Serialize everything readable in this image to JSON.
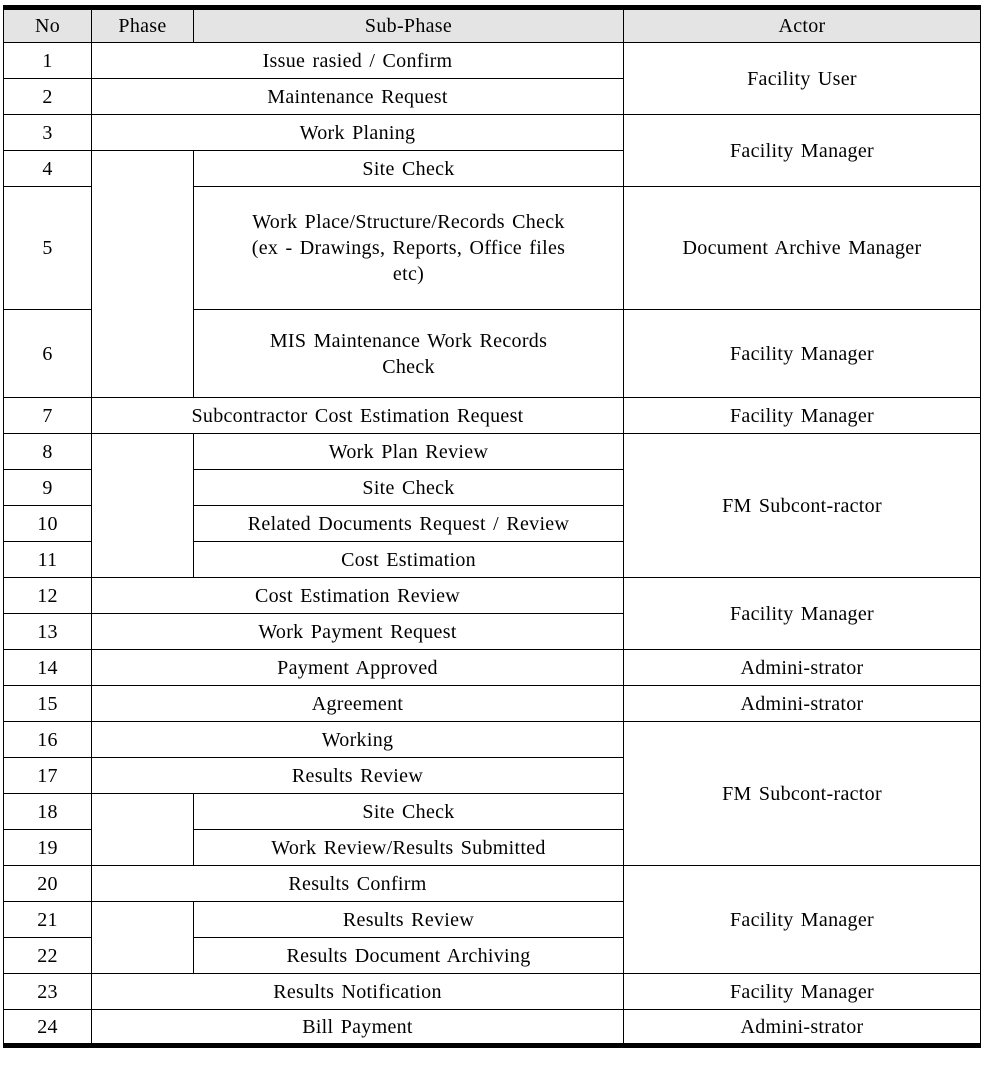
{
  "table": {
    "headers": {
      "no": "No",
      "phase": "Phase",
      "sub_phase": "Sub-Phase",
      "actor": "Actor"
    },
    "header_bg": "#e4e4e4",
    "border_color": "#000000",
    "rows": [
      {
        "no": "1",
        "sub_phase": "Issue rasied / Confirm",
        "indent": false,
        "actor": "Facility User",
        "actor_rowspan": 2
      },
      {
        "no": "2",
        "sub_phase": "Maintenance Request",
        "indent": false,
        "actor": null,
        "actor_rowspan": 0
      },
      {
        "no": "3",
        "sub_phase": "Work Planing",
        "indent": false,
        "actor": "Facility Manager",
        "actor_rowspan": 2
      },
      {
        "no": "4",
        "sub_phase": "Site Check",
        "indent": true,
        "actor": null,
        "actor_rowspan": 0
      },
      {
        "no": "5",
        "sub_phase": "Work Place/Structure/Records Check (ex - Drawings, Reports, Office files etc)",
        "sub_phase_lines": [
          "Work Place/Structure/Records Check",
          "(ex - Drawings, Reports, Office files",
          "etc)"
        ],
        "indent": true,
        "actor": "Document Archive Manager",
        "actor_rowspan": 1
      },
      {
        "no": "6",
        "sub_phase": "MIS Maintenance Work Records Check",
        "sub_phase_lines": [
          "MIS Maintenance Work Records",
          "Check"
        ],
        "indent": true,
        "actor": "Facility Manager",
        "actor_rowspan": 1
      },
      {
        "no": "7",
        "sub_phase": "Subcontractor Cost Estimation Request",
        "indent": false,
        "actor": "Facility Manager",
        "actor_rowspan": 1
      },
      {
        "no": "8",
        "sub_phase": "Work Plan Review",
        "indent": true,
        "actor": "FM Subcont-ractor",
        "actor_rowspan": 4
      },
      {
        "no": "9",
        "sub_phase": "Site Check",
        "indent": true,
        "actor": null,
        "actor_rowspan": 0
      },
      {
        "no": "10",
        "sub_phase": "Related Documents Request / Review",
        "indent": true,
        "actor": null,
        "actor_rowspan": 0
      },
      {
        "no": "11",
        "sub_phase": "Cost Estimation",
        "indent": true,
        "actor": null,
        "actor_rowspan": 0
      },
      {
        "no": "12",
        "sub_phase": "Cost Estimation Review",
        "indent": false,
        "actor": "Facility Manager",
        "actor_rowspan": 2
      },
      {
        "no": "13",
        "sub_phase": "Work Payment Request",
        "indent": false,
        "actor": null,
        "actor_rowspan": 0
      },
      {
        "no": "14",
        "sub_phase": "Payment Approved",
        "indent": false,
        "actor": "Admini-strator",
        "actor_rowspan": 1
      },
      {
        "no": "15",
        "sub_phase": "Agreement",
        "indent": false,
        "actor": "Admini-strator",
        "actor_rowspan": 1
      },
      {
        "no": "16",
        "sub_phase": "Working",
        "indent": false,
        "actor": "FM Subcont-ractor",
        "actor_rowspan": 4
      },
      {
        "no": "17",
        "sub_phase": "Results Review",
        "indent": false,
        "actor": null,
        "actor_rowspan": 0
      },
      {
        "no": "18",
        "sub_phase": "Site Check",
        "indent": true,
        "actor": null,
        "actor_rowspan": 0
      },
      {
        "no": "19",
        "sub_phase": "Work Review/Results Submitted",
        "indent": true,
        "actor": null,
        "actor_rowspan": 0
      },
      {
        "no": "20",
        "sub_phase": "Results Confirm",
        "indent": false,
        "actor": "Facility Manager",
        "actor_rowspan": 3
      },
      {
        "no": "21",
        "sub_phase": "Results Review",
        "indent": true,
        "actor": null,
        "actor_rowspan": 0
      },
      {
        "no": "22",
        "sub_phase": "Results Document Archiving",
        "indent": true,
        "actor": null,
        "actor_rowspan": 0
      },
      {
        "no": "23",
        "sub_phase": "Results Notification",
        "indent": false,
        "actor": "Facility Manager",
        "actor_rowspan": 1
      },
      {
        "no": "24",
        "sub_phase": "Bill Payment",
        "indent": false,
        "actor": "Admini-strator",
        "actor_rowspan": 1
      }
    ]
  }
}
